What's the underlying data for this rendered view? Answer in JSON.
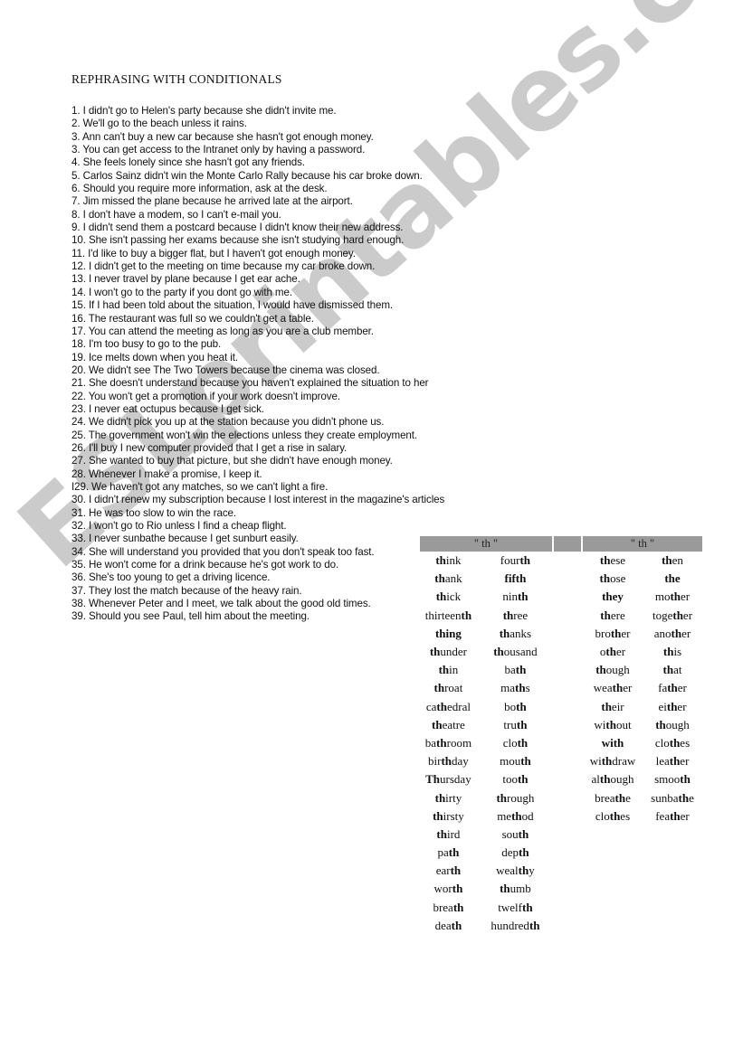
{
  "document": {
    "title": "REPHRASING WITH CONDITIONALS",
    "watermark": "ESLprintables.com",
    "sentences": [
      "1. I didn't go to Helen's party because she didn't invite me.",
      "2. We'll go to the beach unless it rains.",
      "3. Ann can't buy a new car because she hasn't got enough money.",
      "3. You can get access to the Intranet only by having a password.",
      "4. She feels lonely since she hasn't got any friends.",
      "5. Carlos Sainz didn't win the Monte Carlo Rally because his car broke down.",
      "6. Should you require more information, ask at the desk.",
      "7. Jim missed the plane because he arrived late at the airport.",
      "8. I don't have a modem, so I can't e-mail you.",
      "9. I didn't send them a postcard because I didn't know their new address.",
      "10. She isn't passing her exams because she isn't studying hard enough.",
      "11. I'd like to buy a bigger flat, but I haven't got enough money.",
      "12. I didn't get to the meeting on time because my car broke down.",
      "13. I never travel by plane because I get ear ache.",
      "14. I won't go to the party if you dont go with me.",
      "15. If I had been told about the situation, I would have dismissed them.",
      "16. The restaurant was full so we couldn't get a table.",
      "17. You can attend the meeting as long as you are a club member.",
      "18. I'm too busy to go to the pub.",
      "19. Ice melts down when you heat it.",
      "20. We didn't see The Two Towers because the cinema was closed.",
      "21. She doesn't understand because you haven't explained the situation to her",
      "22. You won't get a promotion if your work doesn't improve.",
      "23. I never eat octupus because I get sick.",
      "24. We didn't pick you up at the station because you didn't phone us.",
      "25. The government won't win the elections unless they create employment.",
      "26. I'll buy I new computer provided that I get a rise in salary.",
      "27. She wanted to buy that picture, but she didn't have enough money.",
      "28. Whenever I make a promise, I keep it.",
      "I29. We haven't got any matches, so we can't light a fire.",
      "30. I didn't renew my subscription because I lost interest in the magazine's articles",
      "31. He was too slow to win the race.",
      "32. I won't go to Rio unless I find a cheap flight.",
      "33. I never sunbathe because I get sunburt easily.",
      "34. She will understand you provided that you don't speak too fast.",
      "35. He won't come for a drink because he's got work to do.",
      "36. She's too young to get a driving licence.",
      "37. They lost the match because of the heavy rain.",
      "38. Whenever Peter and I meet, we talk about the good old times.",
      "39. Should you see Paul, tell him about the meeting."
    ]
  },
  "th_table": {
    "header_left": "\" th \"",
    "header_gap": "",
    "header_right": "\" th \"",
    "colors": {
      "header_bg": "#9a9a9a",
      "watermark": "#c9c9c9"
    },
    "unvoiced_col1": [
      [
        "",
        "th",
        "ink"
      ],
      [
        "",
        "th",
        "ank"
      ],
      [
        "",
        "th",
        "ick"
      ],
      [
        "thirteen",
        "th",
        ""
      ],
      [
        "",
        "thing",
        ""
      ],
      [
        "",
        "th",
        "under"
      ],
      [
        "",
        "th",
        "in"
      ],
      [
        "",
        "th",
        "roat"
      ],
      [
        "ca",
        "th",
        "edral"
      ],
      [
        "",
        "th",
        "eatre"
      ],
      [
        "ba",
        "th",
        "room"
      ],
      [
        "bir",
        "th",
        "day"
      ],
      [
        "",
        "Th",
        "ursday"
      ],
      [
        "",
        "th",
        "irty"
      ],
      [
        "",
        "th",
        "irsty"
      ],
      [
        "",
        "th",
        "ird"
      ],
      [
        "pa",
        "th",
        ""
      ],
      [
        "ear",
        "th",
        ""
      ],
      [
        "wor",
        "th",
        ""
      ],
      [
        "brea",
        "th",
        ""
      ],
      [
        "dea",
        "th",
        ""
      ]
    ],
    "unvoiced_col2": [
      [
        "four",
        "th",
        ""
      ],
      [
        "",
        "fifth",
        ""
      ],
      [
        "nin",
        "th",
        ""
      ],
      [
        "",
        "th",
        "ree"
      ],
      [
        "",
        "th",
        "anks"
      ],
      [
        "",
        "th",
        "ousand"
      ],
      [
        "ba",
        "th",
        ""
      ],
      [
        "ma",
        "th",
        "s"
      ],
      [
        "bo",
        "th",
        ""
      ],
      [
        "tru",
        "th",
        ""
      ],
      [
        "clo",
        "th",
        ""
      ],
      [
        "mou",
        "th",
        ""
      ],
      [
        "too",
        "th",
        ""
      ],
      [
        "",
        "th",
        "rough"
      ],
      [
        "me",
        "th",
        "od"
      ],
      [
        "sou",
        "th",
        ""
      ],
      [
        "dep",
        "th",
        ""
      ],
      [
        "weal",
        "th",
        "y"
      ],
      [
        "",
        "th",
        "umb"
      ],
      [
        "twelf",
        "th",
        ""
      ],
      [
        "hundred",
        "th",
        ""
      ]
    ],
    "voiced_col1": [
      [
        "",
        "th",
        "ese"
      ],
      [
        "",
        "th",
        "ose"
      ],
      [
        "",
        "they",
        ""
      ],
      [
        "",
        "th",
        "ere"
      ],
      [
        "bro",
        "th",
        "er"
      ],
      [
        "o",
        "th",
        "er"
      ],
      [
        "",
        "th",
        "ough"
      ],
      [
        "wea",
        "th",
        "er"
      ],
      [
        "",
        "th",
        "eir"
      ],
      [
        "wi",
        "th",
        "out"
      ],
      [
        "",
        "with",
        ""
      ],
      [
        "wi",
        "th",
        "draw"
      ],
      [
        "al",
        "th",
        "ough"
      ],
      [
        "brea",
        "th",
        "e"
      ],
      [
        "clo",
        "th",
        "es"
      ]
    ],
    "voiced_col2": [
      [
        "",
        "th",
        "en"
      ],
      [
        "",
        "the",
        ""
      ],
      [
        "mo",
        "th",
        "er"
      ],
      [
        "toge",
        "th",
        "er"
      ],
      [
        "ano",
        "th",
        "er"
      ],
      [
        "",
        "th",
        "is"
      ],
      [
        "",
        "th",
        "at"
      ],
      [
        "fa",
        "th",
        "er"
      ],
      [
        "ei",
        "th",
        "er"
      ],
      [
        "",
        "th",
        "ough"
      ],
      [
        "clo",
        "th",
        "es"
      ],
      [
        "lea",
        "th",
        "er"
      ],
      [
        "smoo",
        "th",
        ""
      ],
      [
        "sunba",
        "th",
        "e"
      ],
      [
        "fea",
        "th",
        "er"
      ]
    ]
  }
}
